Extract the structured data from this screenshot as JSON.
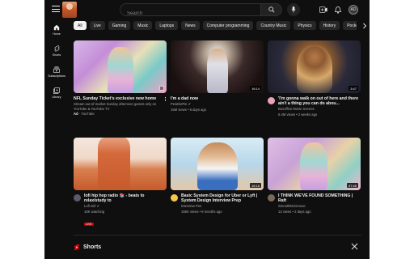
{
  "header": {
    "search_placeholder": "Search",
    "avatar_initials": "AD"
  },
  "sidebar": {
    "items": [
      {
        "label": "Home",
        "icon": "home-icon"
      },
      {
        "label": "Shorts",
        "icon": "shorts-icon"
      },
      {
        "label": "Subscriptions",
        "icon": "subscriptions-icon"
      },
      {
        "label": "Library",
        "icon": "library-icon"
      }
    ]
  },
  "chips": [
    "All",
    "Live",
    "Gaming",
    "Music",
    "Laptops",
    "News",
    "Computer programming",
    "Country Music",
    "Physics",
    "History",
    "Pocket"
  ],
  "videos": [
    {
      "title": "NFL Sunday Ticket's exclusive new home",
      "line1": "Stream out-of-market Sunday afternoon games only on YouTube & YouTube TV",
      "ad_label": "Ad",
      "channel": "YouTube",
      "duration": ""
    },
    {
      "title": "I'm a dad now",
      "channel": "PewDiePie",
      "stats": "15M views • 8 days ago",
      "duration": "16:14"
    },
    {
      "title": "'I'm gonna walk on out of here and there ain't a thing you can do abou...",
      "channel": "Boxoffice Movie Scenes",
      "stats": "6.4M views • 2 weeks ago",
      "duration": "3:47"
    },
    {
      "title": "lofi hip hop radio 📚 - beats to relax/study to",
      "channel": "Lofi Girl",
      "stats": "16K watching",
      "live": "LIVE",
      "duration": ""
    },
    {
      "title": "Basic System Design for Uber or Lyft | System Design Interview Prep",
      "channel": "Interview Pen",
      "stats": "165K views • 8 months ago",
      "duration": "16:18"
    },
    {
      "title": "I THINK WE'VE FOUND SOMETHING | Raft",
      "channel": "SmoothMcGroove",
      "stats": "13 views • 2 days ago",
      "duration": "57:45"
    }
  ],
  "shorts": {
    "label": "Shorts"
  },
  "colors": {
    "bg": "#0f0f0f",
    "chip_active": "#f1f1f1",
    "live_red": "#cc0000",
    "shorts_red": "#ff0000"
  }
}
